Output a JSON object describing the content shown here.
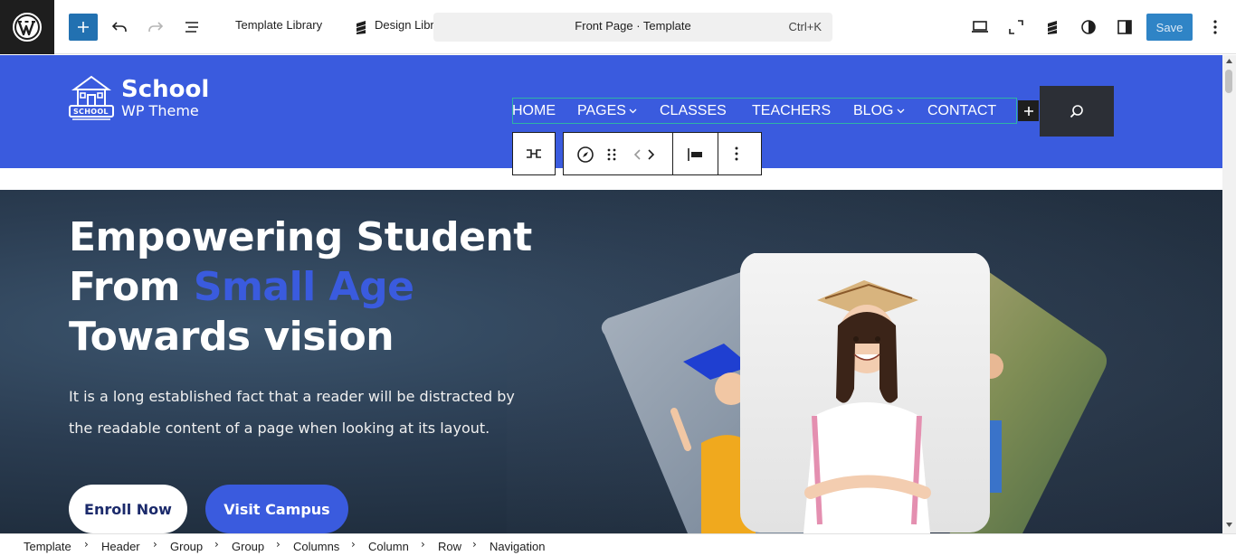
{
  "toolbar": {
    "template_library": "Template Library",
    "design_library": "Design Library",
    "command_title": "Front Page · Template",
    "command_shortcut": "Ctrl+K",
    "save_label": "Save"
  },
  "site": {
    "logo_badge": "SCHOOL",
    "logo_title": "School",
    "logo_subtitle": "WP Theme"
  },
  "nav": {
    "items": [
      "HOME",
      "PAGES",
      "CLASSES",
      "TEACHERS",
      "BLOG",
      "CONTACT"
    ]
  },
  "hero": {
    "line1": "Empowering Student",
    "line2_a": "From ",
    "line2_b": "Small Age",
    "line3": "Towards vision",
    "para1": "It is a long established fact that a reader will be distracted by",
    "para2": "the readable content of a page when looking at its layout.",
    "enroll": "Enroll Now",
    "visit": "Visit Campus"
  },
  "breadcrumbs": [
    "Template",
    "Header",
    "Group",
    "Group",
    "Columns",
    "Column",
    "Row",
    "Navigation"
  ],
  "colors": {
    "brand_blue": "#3a5bde",
    "wp_blue": "#2271b1",
    "dark": "#1e1e1e"
  }
}
